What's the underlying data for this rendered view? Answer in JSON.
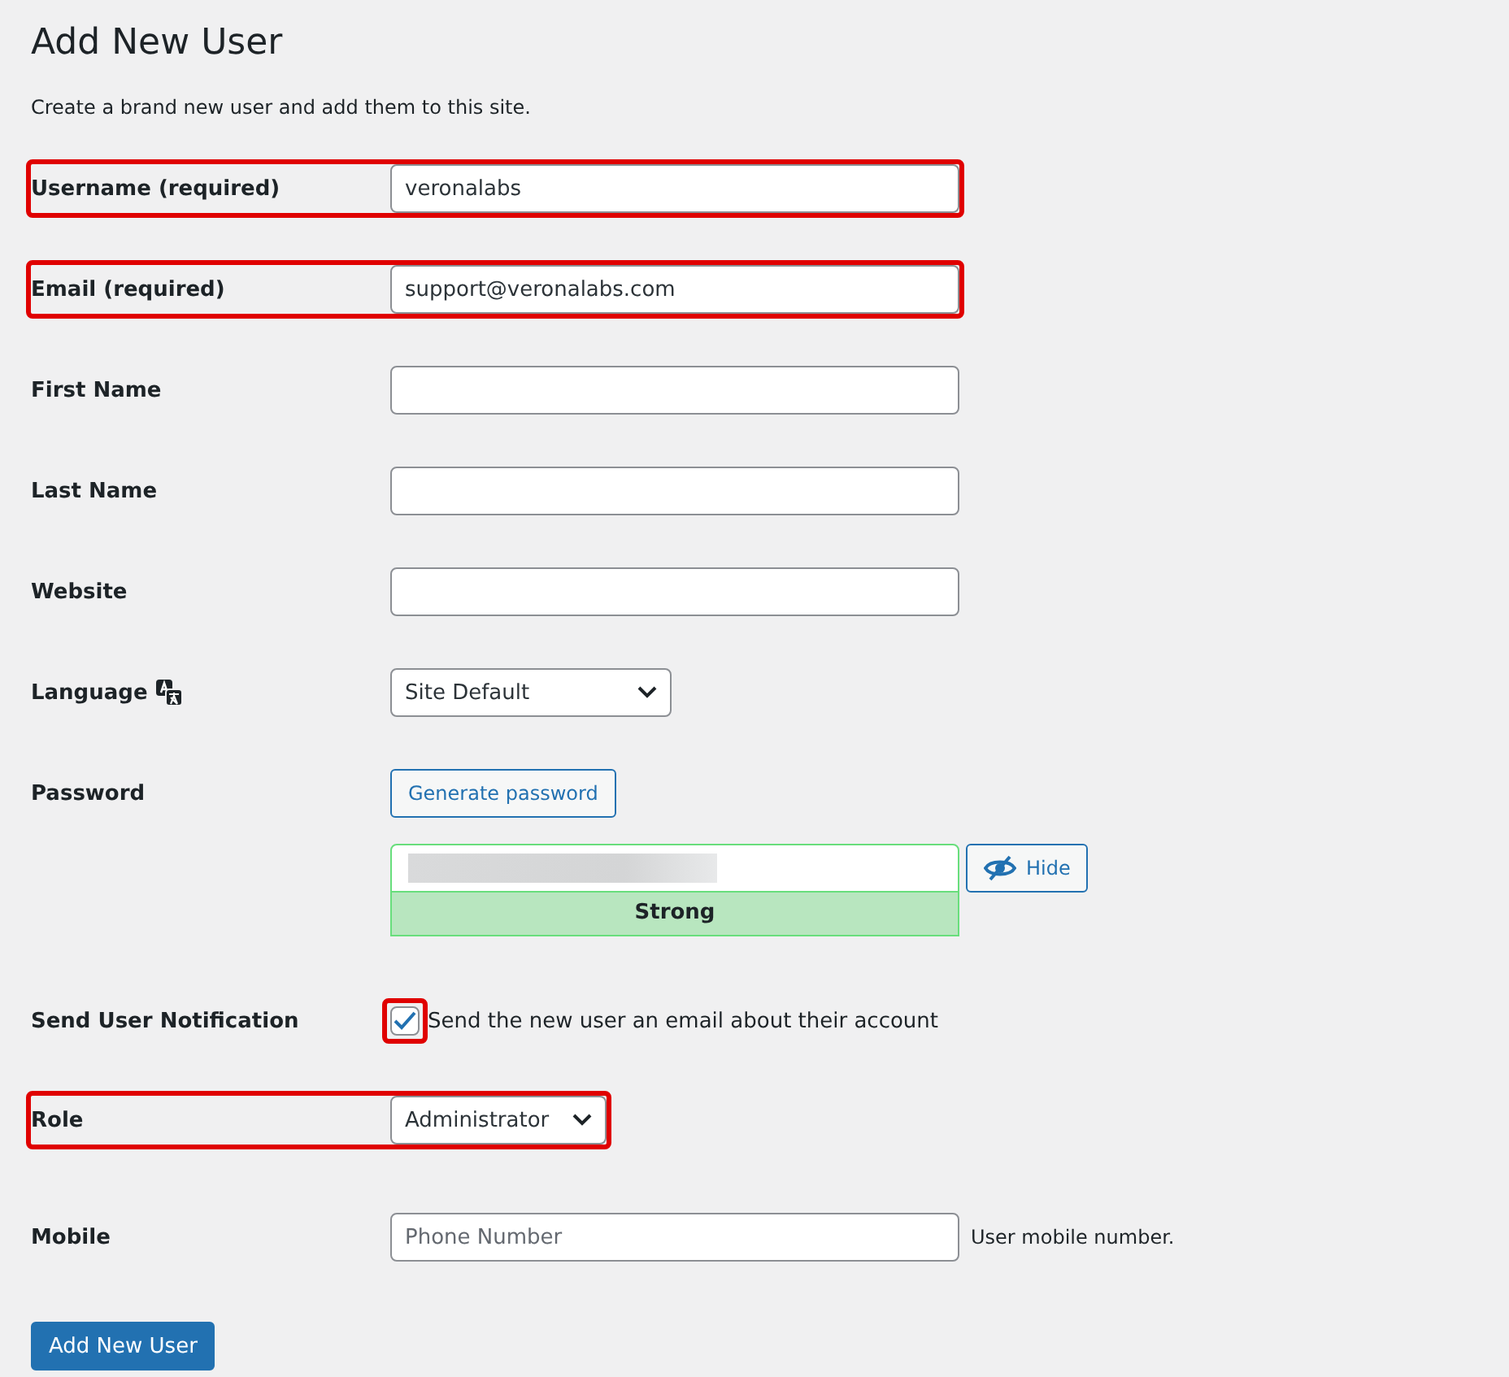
{
  "title": "Add New User",
  "description": "Create a brand new user and add them to this site.",
  "fields": [
    {
      "kind": "text",
      "label": "Username (required)",
      "value": "veronalabs",
      "highlighted": true
    },
    {
      "kind": "text",
      "label": "Email (required)",
      "value": "support@veronalabs.com",
      "highlighted": true
    },
    {
      "kind": "text",
      "label": "First Name",
      "highlighted": false
    },
    {
      "kind": "text",
      "label": "Last Name",
      "highlighted": false
    },
    {
      "kind": "text",
      "label": "Website",
      "highlighted": false
    },
    {
      "kind": "select",
      "label": "Language",
      "value": "Site Default",
      "translate_icon": true,
      "highlighted": false
    },
    {
      "kind": "password",
      "label": "Password",
      "generate_button": "Generate password",
      "value_redacted": true,
      "strength": "Strong",
      "toggle_button": "Hide",
      "highlighted": false
    },
    {
      "kind": "checkbox",
      "label": "Send User Notification",
      "checked": true,
      "option": "Send the new user an email about their account",
      "highlighted": true
    },
    {
      "kind": "select",
      "label": "Role",
      "value": "Administrator",
      "translate_icon": false,
      "highlighted": true
    },
    {
      "kind": "text",
      "label": "Mobile",
      "placeholder": "Phone Number",
      "hint": "User mobile number.",
      "highlighted": false
    }
  ],
  "submit": "Add New User"
}
